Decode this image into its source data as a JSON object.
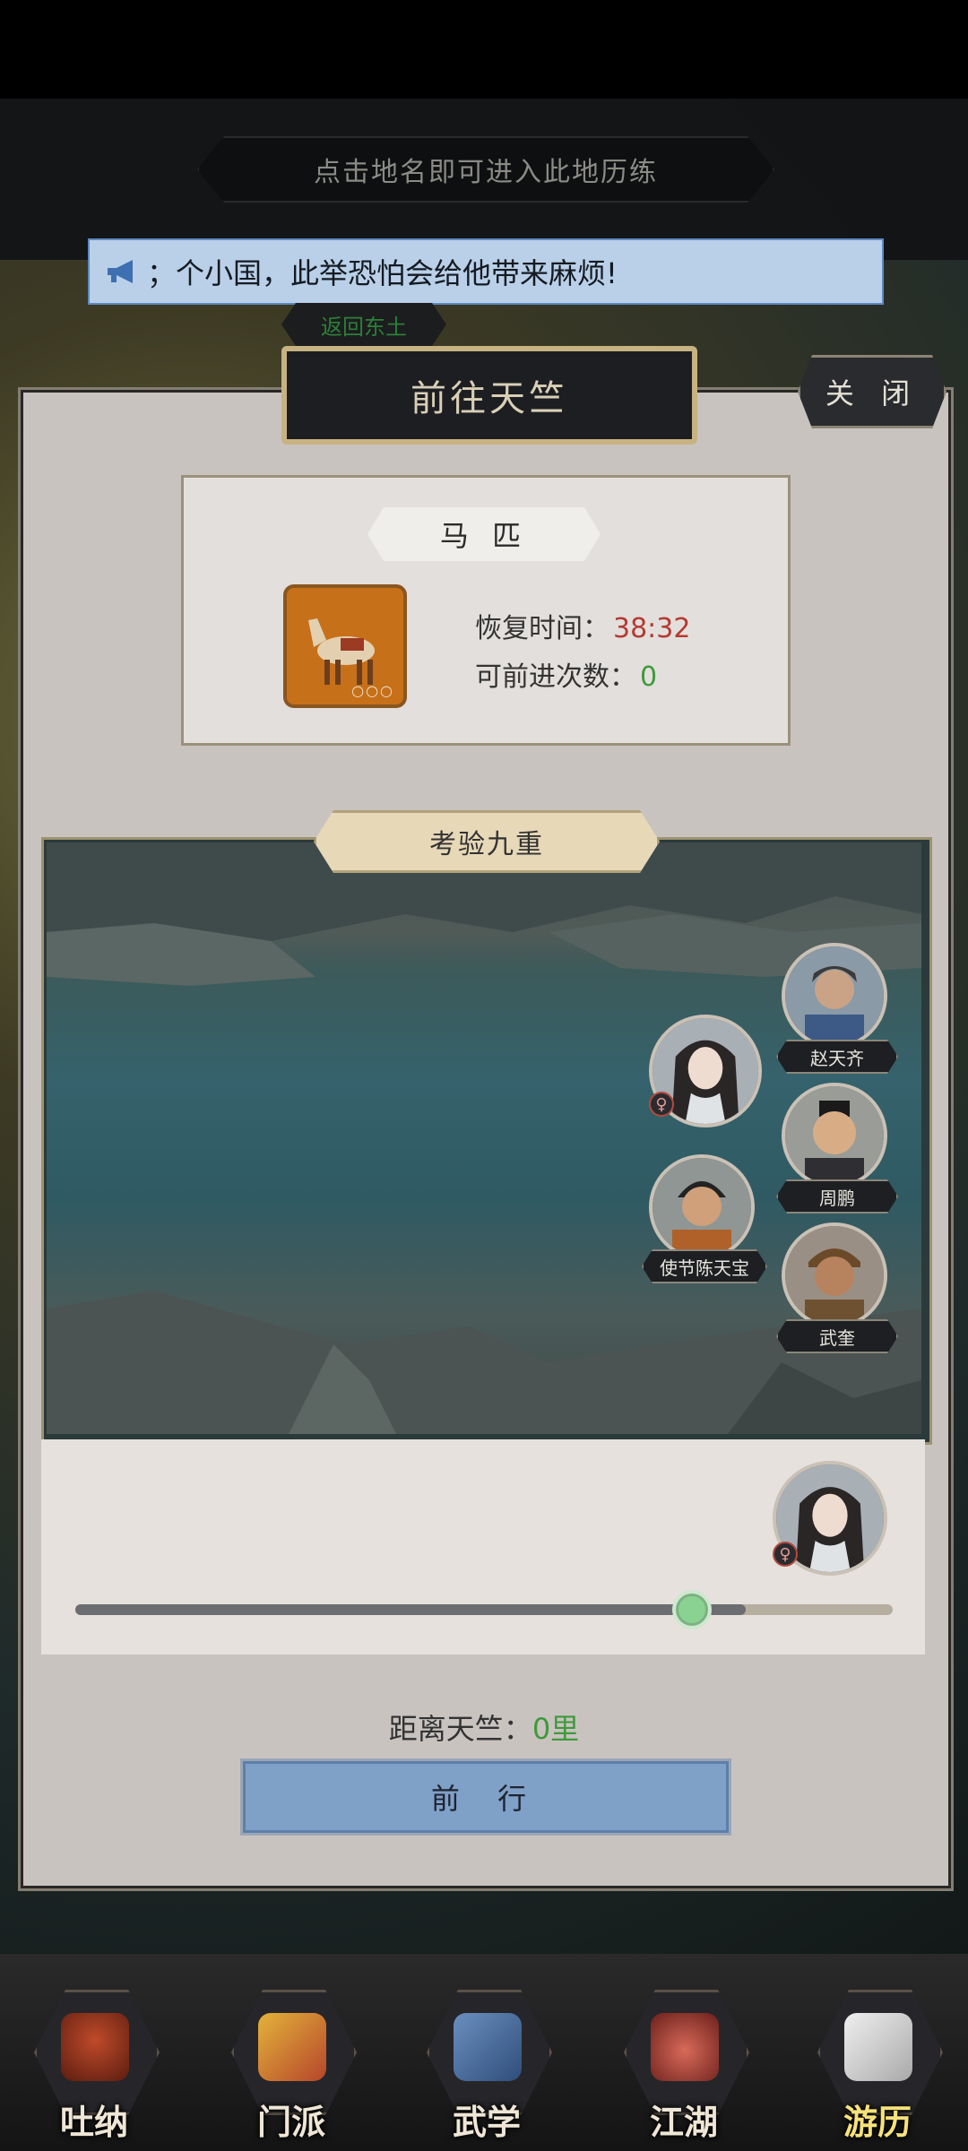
{
  "hint_bar": {
    "text": "点击地名即可进入此地历练"
  },
  "marquee": {
    "text": "；个小国，此举恐怕会给他带来麻烦!",
    "icon": "megaphone-icon"
  },
  "return_tab": {
    "label": "返回东土"
  },
  "dialog": {
    "title": "前往天竺",
    "close_label": "关 闭"
  },
  "horse": {
    "tag": "马 匹",
    "icon_dots": "○○○",
    "recovery_label": "恢复时间：",
    "recovery_value": "38:32",
    "advances_label": "可前进次数：",
    "advances_value": "0"
  },
  "trial": {
    "label": "考验九重",
    "characters": [
      {
        "name": "赵天齐"
      },
      {
        "name": "周鹏"
      },
      {
        "name": "使节陈天宝"
      },
      {
        "name": "武奎"
      }
    ],
    "female_badge": "♀"
  },
  "progress": {
    "fraction": 0.82
  },
  "distance": {
    "label": "距离天竺：",
    "value": "0里"
  },
  "go_button": {
    "label": "前 行"
  },
  "colors": {
    "recovery_value": "#b43a32",
    "advances_value": "#3e9a3b",
    "go_button": "#7fa0c7"
  },
  "bottom_nav": [
    {
      "label": "吐纳",
      "icon": "meditation-icon"
    },
    {
      "label": "门派",
      "icon": "banner-icon"
    },
    {
      "label": "武学",
      "icon": "manual-icon"
    },
    {
      "label": "江湖",
      "icon": "straw-hat-icon"
    },
    {
      "label": "游历",
      "icon": "horse-icon",
      "active": true
    }
  ]
}
